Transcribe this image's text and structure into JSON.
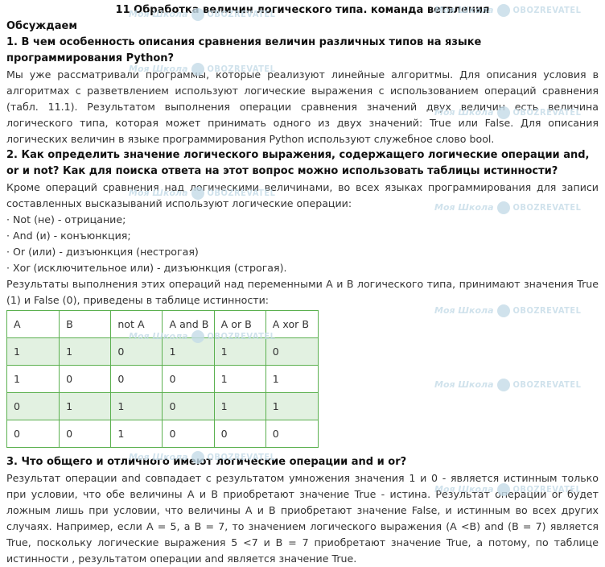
{
  "title": "11 Обработка величин логического типа. команда ветвления",
  "subtitle": "Обсуждаем",
  "sections": [
    {
      "question": "1. В чем особенность описания сравнения величин различных типов на языке программирования Python?",
      "paragraphs": [
        "Мы уже рассматривали программы, которые реализуют линейные алгоритмы. Для описания условия в алгоритмах с разветвлением используют логические выражения с использованием операций сравнения (табл. 11.1). Результатом выполнения операции сравнения значений двух величин есть величина логического типа, которая может принимать одного из двух значений: True или False. Для описания логических величин в языке программирования Python используют служебное слово bool."
      ]
    },
    {
      "question": "2. Как определить значение логического выражения, содержащего логические операции and, or и not? Как для поиска ответа на этот вопрос можно использовать таблицы истинности?",
      "intro": "Кроме операций сравнения над логическими величинами, во всех языках программирования для записи составленных высказываний используют логические операции:",
      "operations": [
        "· Not (не) - отрицание;",
        "· And (и) - конъюнкция;",
        "· Or (или) - дизъюнкция (нестрогая)",
        "· Xor (исключительное или) - дизъюнкция (строгая)."
      ],
      "outro": "Результаты выполнения этих операций над переменными A и B логического типа, принимают значения True (1) и False (0), приведены в таблице истинности:"
    },
    {
      "question": "3. Что общего и отличного имеют логические операции and и or?",
      "paragraphs": [
        "Результат операции and совпадает с результатом умножения значения 1 и 0 - является истинным только при условии, что обе величины A и B приобретают значение True - истина. Результат операции or будет ложным лишь при условии, что величины A и B приобретают значение False, и истинным во всех других случаях. Например, если A = 5, а B = 7, то значением логического выражения (A <B) and (B = 7) является True, поскольку логические выражения 5 <7 и B = 7 приобретают значение True, а потому, по таблице истинности , результатом операции and является значение True."
      ]
    }
  ],
  "truth_table": {
    "headers": [
      "A",
      "B",
      "not A",
      "A and B",
      "A or B",
      "A xor B"
    ],
    "rows": [
      [
        "1",
        "1",
        "0",
        "1",
        "1",
        "0"
      ],
      [
        "1",
        "0",
        "0",
        "0",
        "1",
        "1"
      ],
      [
        "0",
        "1",
        "1",
        "0",
        "1",
        "1"
      ],
      [
        "0",
        "0",
        "1",
        "0",
        "0",
        "0"
      ]
    ]
  },
  "watermark": {
    "school": "Моя Школа",
    "brand": "OBOZREVATEL"
  },
  "colors": {
    "table_border": "#5bb04f",
    "row_highlight": "#e2f1e1",
    "watermark": "#c5dce8"
  }
}
